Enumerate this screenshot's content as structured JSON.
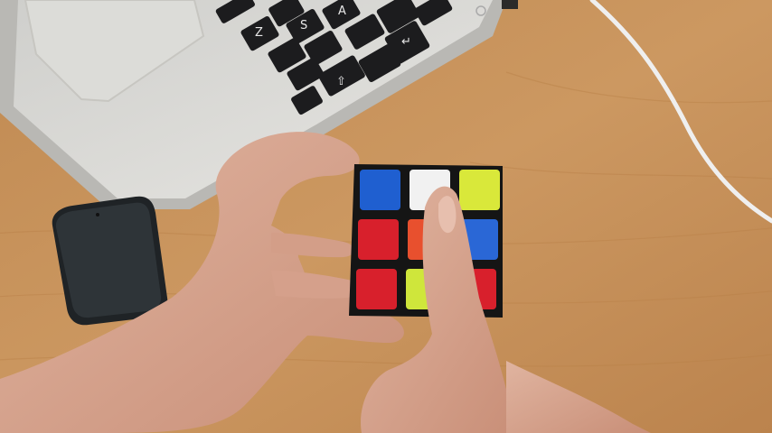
{
  "scene": {
    "description_free": true,
    "palette": {
      "table": "#c8935a",
      "table_dark": "#b47c46",
      "laptop": "#d9d9d6",
      "keyboard_key": "#1c1c1e",
      "phone": "#2b2f33",
      "cable": "#eeeeee",
      "skin": "#d9a993",
      "cube_body": "#151515"
    },
    "keyboard_keys": [
      {
        "label": "",
        "id": "k1"
      },
      {
        "label": "Z",
        "id": "k2"
      },
      {
        "label": "S",
        "id": "k3"
      },
      {
        "label": "A",
        "id": "k4"
      },
      {
        "label": "↵",
        "id": "k5"
      },
      {
        "label": "",
        "id": "k6"
      },
      {
        "label": "⇧",
        "id": "k7"
      }
    ],
    "cube_face": {
      "stickers": [
        [
          "#1f5fd0",
          "#f1f1f1",
          "#d9e83a"
        ],
        [
          "#d8202c",
          "#e8502e",
          "#2a67d6"
        ],
        [
          "#d8202c",
          "#cfe63b",
          "#d8202c"
        ]
      ]
    }
  }
}
